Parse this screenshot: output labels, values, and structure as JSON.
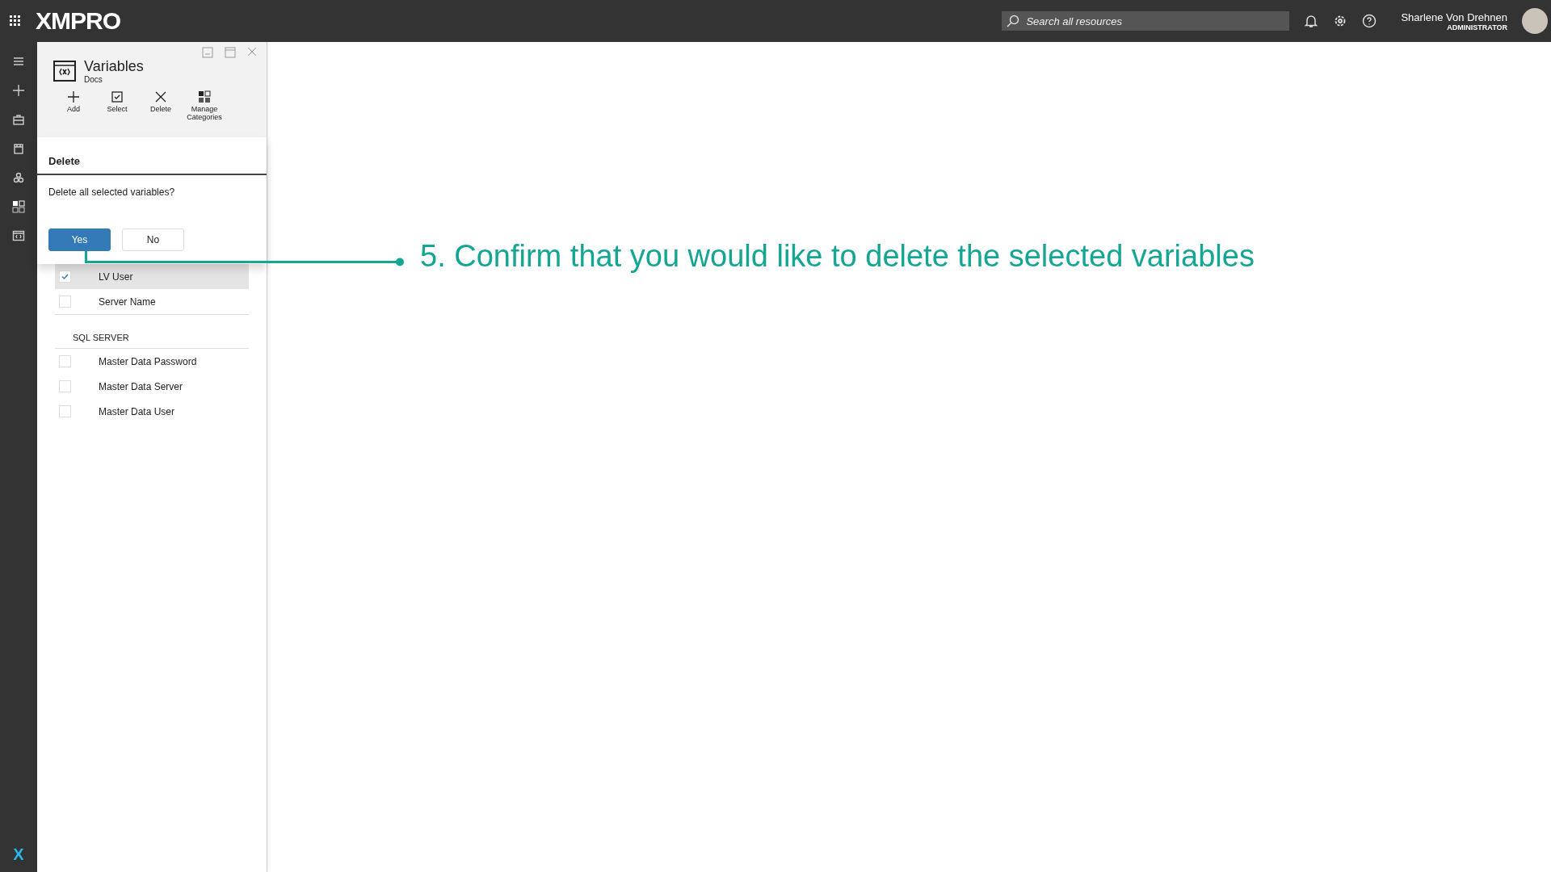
{
  "app_bar": {
    "logo": "XMPRO",
    "search": {
      "placeholder": "Search all resources"
    },
    "user": {
      "name": "Sharlene Von Drehnen",
      "role": "ADMINISTRATOR"
    }
  },
  "sidebar": {
    "items": [
      {
        "kind": "menu"
      },
      {
        "kind": "add"
      },
      {
        "kind": "briefcase"
      },
      {
        "kind": "box"
      },
      {
        "kind": "gears"
      },
      {
        "kind": "apps"
      },
      {
        "kind": "variables"
      }
    ],
    "footer_logo": "X"
  },
  "panel": {
    "title": "Variables",
    "subtitle": "Docs",
    "toolbar": [
      {
        "kind": "add",
        "label": "Add"
      },
      {
        "kind": "select",
        "label": "Select"
      },
      {
        "kind": "delete",
        "label": "Delete"
      },
      {
        "kind": "categories",
        "label": "Manage Categories"
      }
    ]
  },
  "dialog": {
    "title": "Delete",
    "message": "Delete all selected variables?",
    "buttons": [
      {
        "label": "Yes",
        "primary": true
      },
      {
        "label": "No",
        "primary": false
      }
    ]
  },
  "list": {
    "groups": [
      {
        "items": [
          {
            "label": "LV User",
            "checked": true,
            "selected": true
          },
          {
            "label": "Server Name",
            "checked": false,
            "selected": false
          }
        ]
      },
      {
        "title": "SQL SERVER",
        "items": [
          {
            "label": "Master Data Password",
            "checked": false,
            "selected": false
          },
          {
            "label": "Master Data Server",
            "checked": false,
            "selected": false
          },
          {
            "label": "Master Data User",
            "checked": false,
            "selected": false
          }
        ]
      }
    ]
  },
  "annotation": {
    "text": "5. Confirm that you would like to delete the selected variables"
  }
}
